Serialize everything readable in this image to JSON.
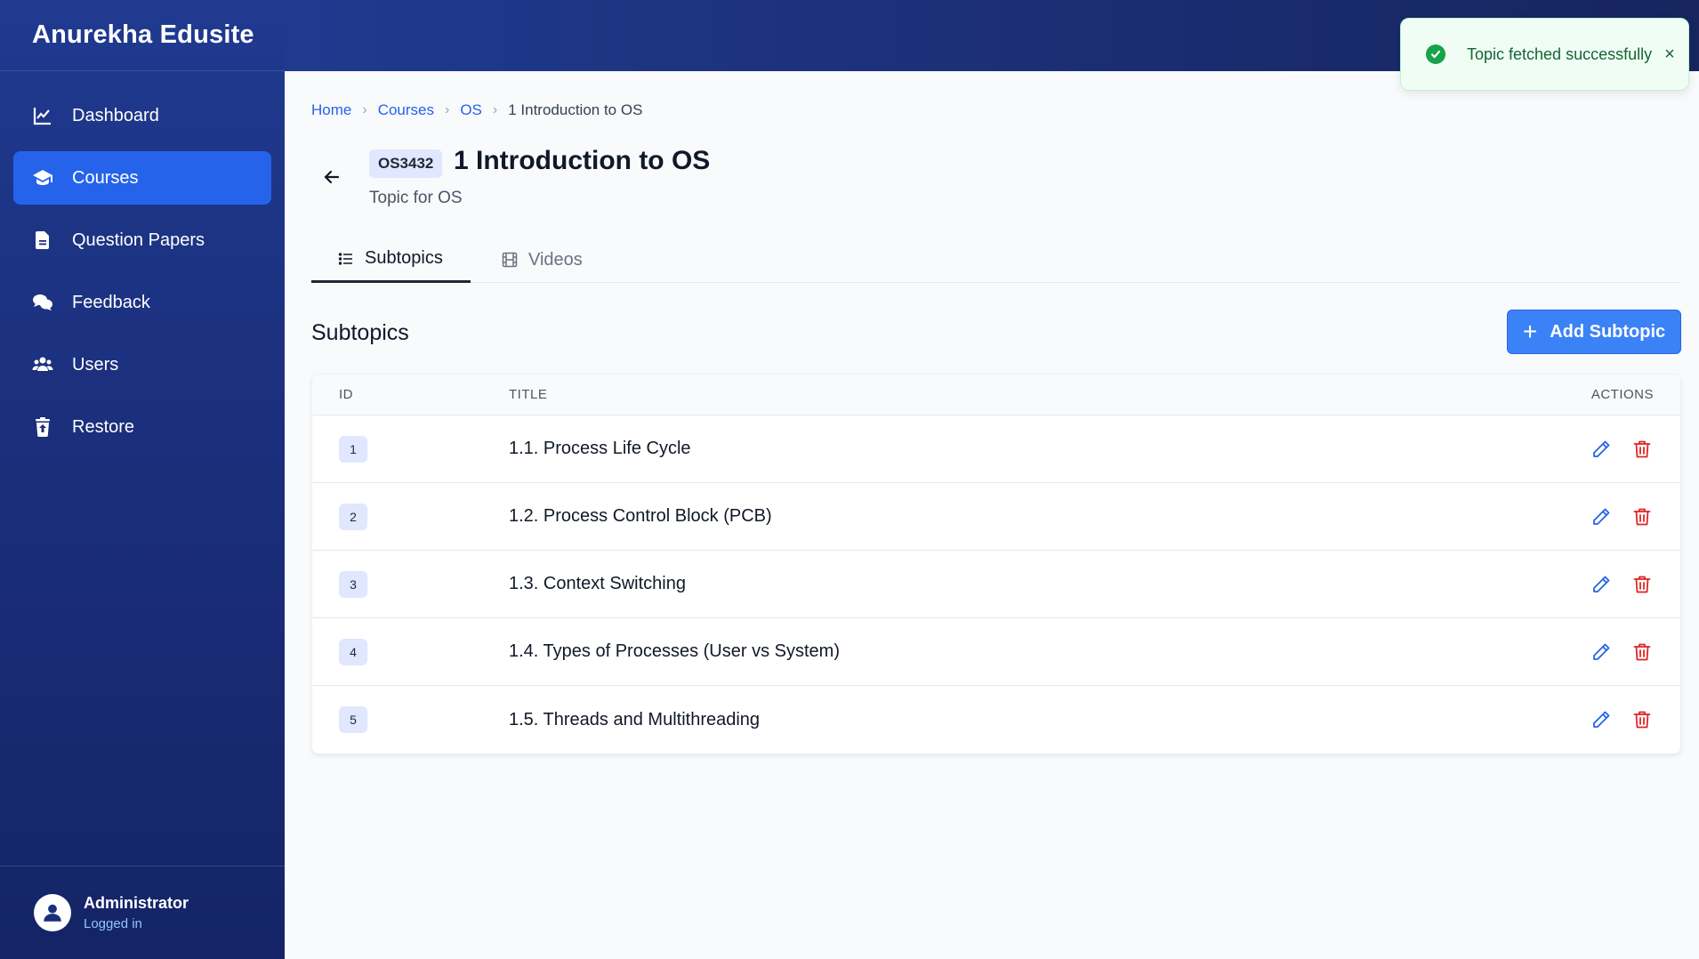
{
  "app": {
    "brand": "Anurekha Edusite"
  },
  "sidebar": {
    "items": [
      {
        "label": "Dashboard",
        "icon": "chart-line-icon",
        "active": false
      },
      {
        "label": "Courses",
        "icon": "graduation-cap-icon",
        "active": true
      },
      {
        "label": "Question Papers",
        "icon": "document-icon",
        "active": false
      },
      {
        "label": "Feedback",
        "icon": "comments-icon",
        "active": false
      },
      {
        "label": "Users",
        "icon": "users-icon",
        "active": false
      },
      {
        "label": "Restore",
        "icon": "trash-restore-icon",
        "active": false
      }
    ],
    "user": {
      "name": "Administrator",
      "status": "Logged in"
    }
  },
  "toast": {
    "message": "Topic fetched successfully",
    "close": "×"
  },
  "breadcrumb": {
    "home": "Home",
    "courses": "Courses",
    "course": "OS",
    "current": "1 Introduction to OS"
  },
  "topic": {
    "code": "OS3432",
    "title": "1 Introduction to OS",
    "subtitle": "Topic for OS"
  },
  "tabs": {
    "subtopics": "Subtopics",
    "videos": "Videos",
    "active": "Subtopics"
  },
  "section": {
    "title": "Subtopics",
    "add_label": "Add Subtopic"
  },
  "table": {
    "headers": {
      "id": "ID",
      "title": "TITLE",
      "actions": "ACTIONS"
    },
    "rows": [
      {
        "id": "1",
        "title": "1.1. Process Life Cycle"
      },
      {
        "id": "2",
        "title": "1.2. Process Control Block (PCB)"
      },
      {
        "id": "3",
        "title": "1.3. Context Switching"
      },
      {
        "id": "4",
        "title": "1.4. Types of Processes (User vs System)"
      },
      {
        "id": "5",
        "title": "1.5. Threads and Multithreading"
      }
    ]
  },
  "colors": {
    "sidebar": "#1b2f7c",
    "accent": "#2563eb",
    "button": "#3b82f6",
    "edit": "#2563eb",
    "delete": "#dc2626",
    "success": "#16a34a"
  }
}
